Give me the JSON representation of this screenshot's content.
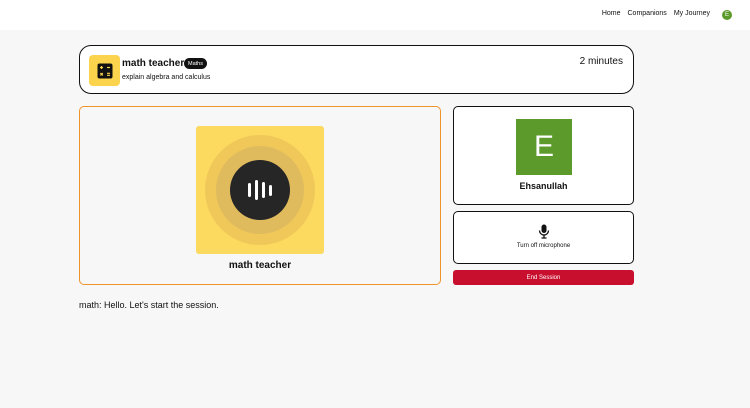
{
  "nav": {
    "links": [
      "Home",
      "Companions",
      "My Journey"
    ],
    "avatar_initial": "E"
  },
  "session": {
    "companion_name": "math teacher",
    "subject": "Maths",
    "topic": "explain algebra and calculus",
    "duration": "2 minutes",
    "subject_icon": "calculator-icon"
  },
  "companion_panel": {
    "label": "math teacher",
    "visual_icon": "voice-wave-icon"
  },
  "user": {
    "initial": "E",
    "name": "Ehsanullah"
  },
  "mic": {
    "label": "Turn off microphone",
    "icon": "microphone-icon"
  },
  "end_button": {
    "label": "End Session"
  },
  "transcript": {
    "message": "math: Hello. Let's start the session."
  },
  "colors": {
    "accent_yellow": "#fcd34d",
    "active_border": "#f0932b",
    "user_green": "#5c9a2c",
    "end_red": "#c8102e"
  }
}
